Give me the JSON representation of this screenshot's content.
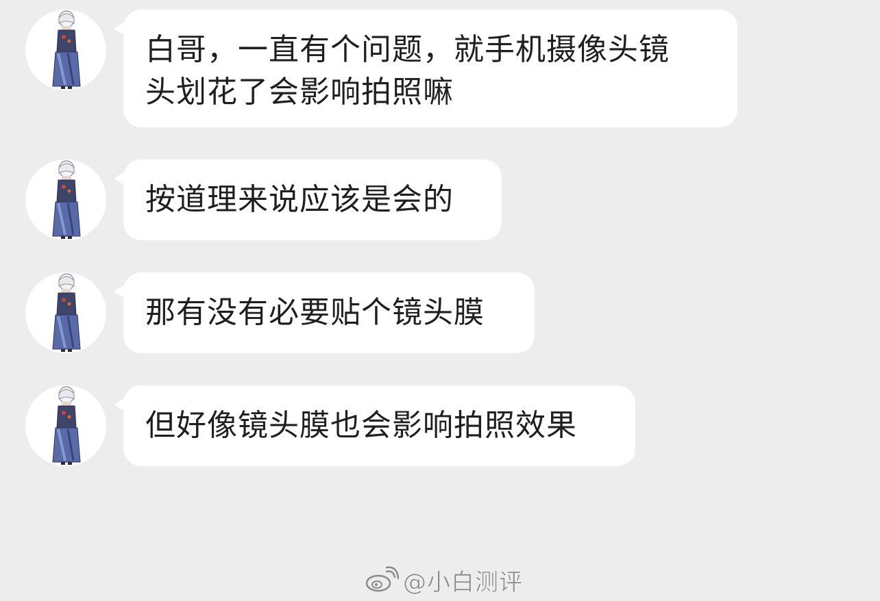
{
  "chat": {
    "messages": [
      {
        "text": "白哥，一直有个问题，就手机摄像头镜\n头划花了会影响拍照嘛"
      },
      {
        "text": "按道理来说应该是会的"
      },
      {
        "text": "那有没有必要贴个镜头膜"
      },
      {
        "text": "但好像镜头膜也会影响拍照效果"
      }
    ]
  },
  "watermark": {
    "text": "@小白测评",
    "icon": "weibo-icon"
  },
  "colors": {
    "background": "#ededed",
    "bubble": "#ffffff",
    "text": "#1f1f1f",
    "watermark": "#8a8a8a"
  }
}
